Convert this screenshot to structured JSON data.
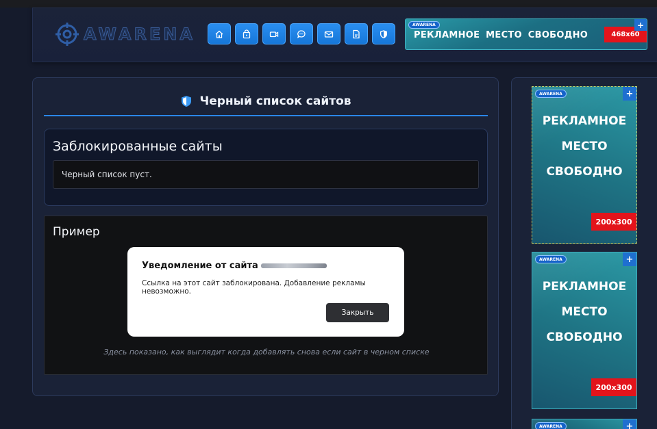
{
  "header": {
    "logo_text": "AWARENA",
    "nav": [
      {
        "icon": "home-icon"
      },
      {
        "icon": "lock-bag-icon"
      },
      {
        "icon": "video-icon"
      },
      {
        "icon": "chat-icon"
      },
      {
        "icon": "mail-icon"
      },
      {
        "icon": "document-icon"
      },
      {
        "icon": "shield-icon"
      }
    ],
    "ad": {
      "tag": "AWARENA",
      "text": "РЕКЛАМНОЕ  МЕСТО СВОБОДНО",
      "size": "468x60",
      "plus": "+"
    }
  },
  "main": {
    "title": "Черный список сайтов",
    "blocked": {
      "heading": "Заблокированные сайты",
      "empty_text": "Черный список пуст."
    },
    "example": {
      "heading": "Пример",
      "notification": {
        "title": "Уведомление от сайта",
        "message": "Ссылка на этот сайт заблокирована. Добавление рекламы невозможно.",
        "close_label": "Закрыть"
      },
      "caption": "Здесь показано, как выглядит когда добавлять снова если сайт в черном списке"
    }
  },
  "sidebar": {
    "ads": [
      {
        "tag": "AWARENA",
        "line1": "РЕКЛАМНОЕ",
        "line2": "МЕСТО",
        "line3": "СВОБОДНО",
        "size": "200x300",
        "plus": "+"
      },
      {
        "tag": "AWARENA",
        "line1": "РЕКЛАМНОЕ",
        "line2": "МЕСТО",
        "line3": "СВОБОДНО",
        "size": "200x300",
        "plus": "+"
      },
      {
        "tag": "AWARENA",
        "plus": "+"
      }
    ]
  },
  "colors": {
    "background": "#151b2c",
    "panel": "#1a2237",
    "accent": "#2a86e8",
    "ad_size_red": "#e3141b"
  }
}
